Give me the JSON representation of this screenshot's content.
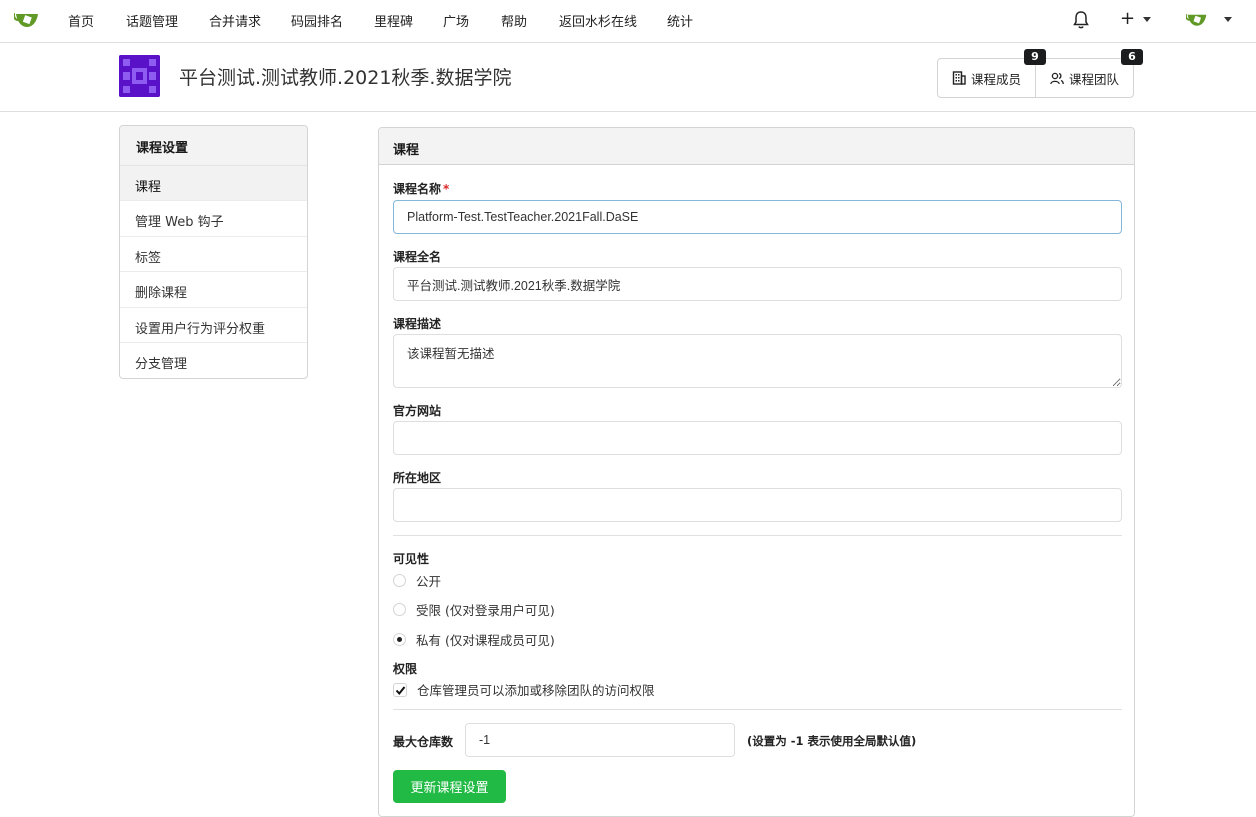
{
  "nav": {
    "items": [
      "首页",
      "话题管理",
      "合并请求",
      "码园排名",
      "里程碑",
      "广场",
      "帮助",
      "返回水杉在线",
      "统计"
    ],
    "plus_label": "+"
  },
  "header": {
    "title": "平台测试.测试教师.2021秋季.数据学院",
    "members_label": "课程成员",
    "members_count": "9",
    "teams_label": "课程团队",
    "teams_count": "6"
  },
  "sidebar": {
    "title": "课程设置",
    "items": [
      "课程",
      "管理 Web 钩子",
      "标签",
      "删除课程",
      "设置用户行为评分权重",
      "分支管理"
    ],
    "active_index": 0
  },
  "form": {
    "panel_title": "课程",
    "name_label": "课程名称",
    "name_required": "*",
    "name_value": "Platform-Test.TestTeacher.2021Fall.DaSE",
    "fullname_label": "课程全名",
    "fullname_value": "平台测试.测试教师.2021秋季.数据学院",
    "desc_label": "课程描述",
    "desc_value": "该课程暂无描述",
    "website_label": "官方网站",
    "website_value": "",
    "location_label": "所在地区",
    "location_value": "",
    "visibility_label": "可见性",
    "visibility_options": [
      "公开",
      "受限 (仅对登录用户可见)",
      "私有 (仅对课程成员可见)"
    ],
    "visibility_selected": 2,
    "permission_label": "权限",
    "permission_checkbox": "仓库管理员可以添加或移除团队的访问权限",
    "permission_checked": true,
    "max_repos_label": "最大仓库数",
    "max_repos_value": "-1",
    "max_repos_hint": "(设置为 -1 表示使用全局默认值)",
    "save_label": "更新课程设置"
  },
  "colors": {
    "brand_green": "#609926",
    "save_button": "#21ba45",
    "course_logo": "#5a12c9"
  }
}
